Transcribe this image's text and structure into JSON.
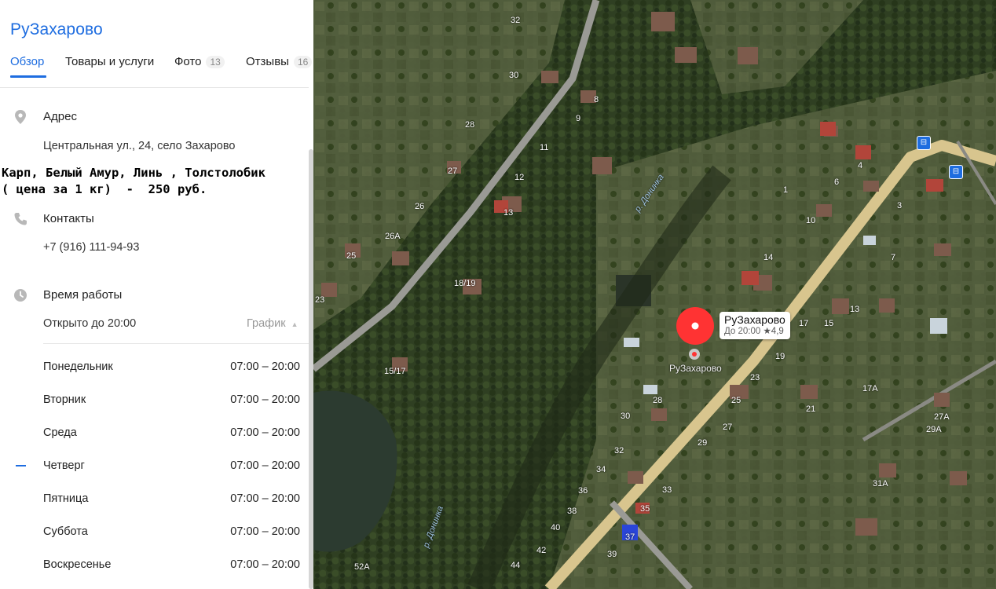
{
  "panel": {
    "title": "РуЗахарово",
    "tabs": [
      {
        "label": "Обзор",
        "count": ""
      },
      {
        "label": "Товары и услуги",
        "count": ""
      },
      {
        "label": "Фото",
        "count": "13"
      },
      {
        "label": "Отзывы",
        "count": "16"
      }
    ],
    "address": {
      "label": "Адрес",
      "value": "Центральная ул., 24, село Захарово"
    },
    "promo": {
      "line1": "Карп, Белый Амур, Линь , Толстолобик",
      "line2": "( цена за 1 кг)  -  250 руб."
    },
    "contacts": {
      "label": "Контакты",
      "phone": "+7 (916) 111-94-93"
    },
    "hours": {
      "label": "Время работы",
      "status": "Открыто до 20:00",
      "schedule_link": "График",
      "days": [
        {
          "day": "Понедельник",
          "time": "07:00 – 20:00",
          "today": false
        },
        {
          "day": "Вторник",
          "time": "07:00 – 20:00",
          "today": false
        },
        {
          "day": "Среда",
          "time": "07:00 – 20:00",
          "today": false
        },
        {
          "day": "Четверг",
          "time": "07:00 – 20:00",
          "today": true
        },
        {
          "day": "Пятница",
          "time": "07:00 – 20:00",
          "today": false
        },
        {
          "day": "Суббота",
          "time": "07:00 – 20:00",
          "today": false
        },
        {
          "day": "Воскресенье",
          "time": "07:00 – 20:00",
          "today": false
        }
      ]
    }
  },
  "map": {
    "pin": {
      "name": "РуЗахарово",
      "hours": "До 20:00",
      "rating": "★4,9",
      "caption": "РуЗахарово"
    },
    "river_label_1": "р. Донинка",
    "river_label_2": "р. Донинка",
    "house_numbers": [
      "32",
      "30",
      "28",
      "27",
      "26",
      "26А",
      "25",
      "23",
      "18/19",
      "15/17",
      "13",
      "12",
      "11",
      "9",
      "8",
      "6",
      "4",
      "3",
      "10",
      "14",
      "13",
      "15",
      "17",
      "19",
      "21",
      "23",
      "25",
      "27",
      "29",
      "30",
      "28",
      "32",
      "34",
      "36",
      "38",
      "40",
      "42",
      "44",
      "33",
      "35",
      "37",
      "39",
      "17А",
      "27А",
      "29А",
      "31А",
      "52А",
      "1",
      "7"
    ],
    "colors": {
      "pin_red": "#ff3333",
      "accent_blue": "#1e6de0"
    }
  }
}
